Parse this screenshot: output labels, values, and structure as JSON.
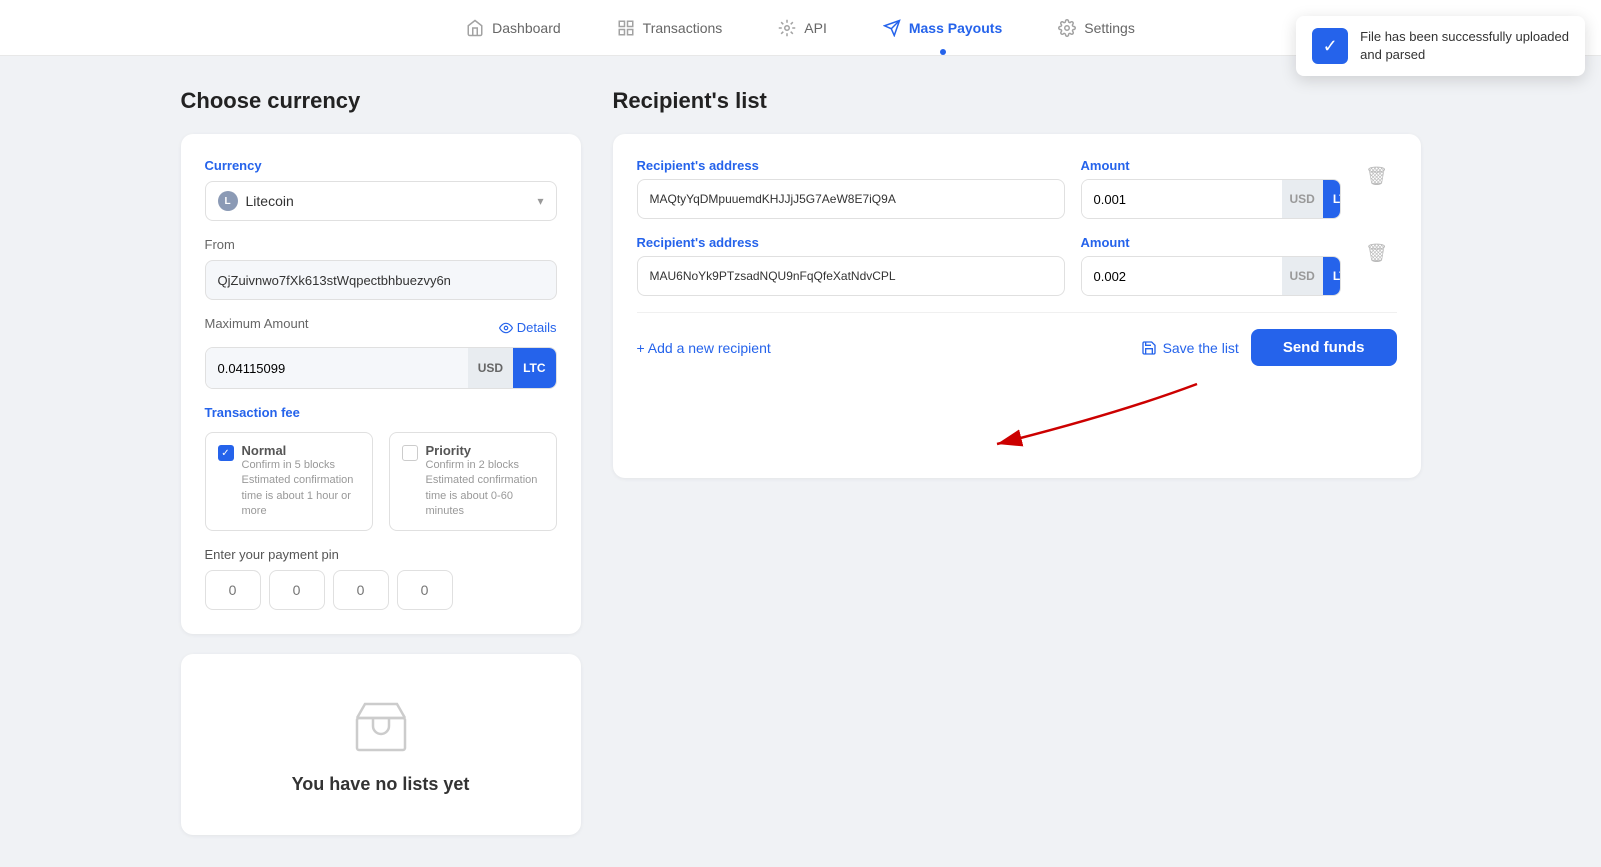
{
  "nav": {
    "items": [
      {
        "id": "dashboard",
        "label": "Dashboard",
        "icon": "home",
        "active": false
      },
      {
        "id": "transactions",
        "label": "Transactions",
        "icon": "list",
        "active": false
      },
      {
        "id": "api",
        "label": "API",
        "icon": "api",
        "active": false
      },
      {
        "id": "mass-payouts",
        "label": "Mass Payouts",
        "icon": "send",
        "active": true
      },
      {
        "id": "settings",
        "label": "Settings",
        "icon": "gear",
        "active": false
      }
    ]
  },
  "toast": {
    "message_line1": "File has been successfully uploaded",
    "message_line2": "and parsed"
  },
  "left": {
    "section_title": "Choose currency",
    "currency_label": "Currency",
    "currency_value": "Litecoin",
    "from_label": "From",
    "from_value": "QjZuivnwo7fXk613stWqpectbhbuezvy6n",
    "max_amount_label": "Maximum Amount",
    "details_label": "Details",
    "max_amount_value": "0.04115099",
    "currency_usd": "USD",
    "currency_ltc": "LTC",
    "tx_fee_label": "Transaction fee",
    "fee_normal_name": "Normal",
    "fee_normal_desc": "Confirm in 5 blocks Estimated confirmation time is about 1 hour or more",
    "fee_priority_name": "Priority",
    "fee_priority_desc": "Confirm in 2 blocks Estimated confirmation time is about 0-60 minutes",
    "pin_label": "Enter your payment pin",
    "pin_placeholder_1": "0",
    "pin_placeholder_2": "0",
    "pin_placeholder_3": "0",
    "pin_placeholder_4": "0"
  },
  "no_lists": {
    "text": "You have no lists yet"
  },
  "right": {
    "section_title": "Recipient's list",
    "recipients_address_label": "Recipient's address",
    "amount_label": "Amount",
    "row1": {
      "address": "MAQtyYqDMpuuemdKHJJjJ5G7AeW8E7iQ9A",
      "amount": "0.001"
    },
    "row2": {
      "address": "MAU6NoYk9PTzsadNQU9nFqQfeXatNdvCPL",
      "amount": "0.002"
    },
    "add_recipient_label": "+ Add a new recipient",
    "save_list_label": "Save the list",
    "send_funds_label": "Send funds"
  }
}
